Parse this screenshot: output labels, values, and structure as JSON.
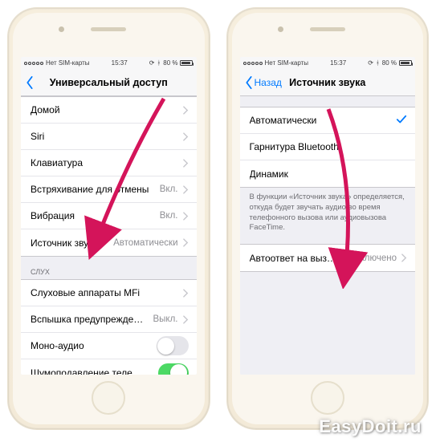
{
  "status": {
    "carrier": "Нет SIM-карты",
    "time": "15:37",
    "battery_pct": "80 %"
  },
  "left": {
    "nav": {
      "title": "Универсальный доступ"
    },
    "rows": {
      "home": "Домой",
      "siri": "Siri",
      "keyboard": "Клавиатура",
      "shake": {
        "label": "Встряхивание для отмены",
        "value": "Вкл."
      },
      "vibration": {
        "label": "Вибрация",
        "value": "Вкл."
      },
      "audio_source": {
        "label": "Источник звука",
        "value": "Автоматически"
      }
    },
    "section_hearing": "слух",
    "rows2": {
      "mfi": "Слуховые аппараты MFi",
      "flash": {
        "label": "Вспышка предупреждений",
        "value": "Выкл."
      },
      "mono": "Моно-аудио",
      "noise": "Шумоподавление телефона"
    }
  },
  "right": {
    "nav": {
      "back": "Назад",
      "title": "Источник звука"
    },
    "rows": {
      "auto": "Автоматически",
      "bt": "Гарнитура Bluetooth",
      "speaker": "Динамик"
    },
    "footer": "В функции «Источник звука» определяется, откуда будет звучать аудио во время телефонного вызова или аудиовызова FaceTime.",
    "rows2": {
      "autoanswer": {
        "label": "Автоответ на вызовы",
        "value": "Выключено"
      }
    }
  },
  "watermark": "EasyDoit.ru"
}
